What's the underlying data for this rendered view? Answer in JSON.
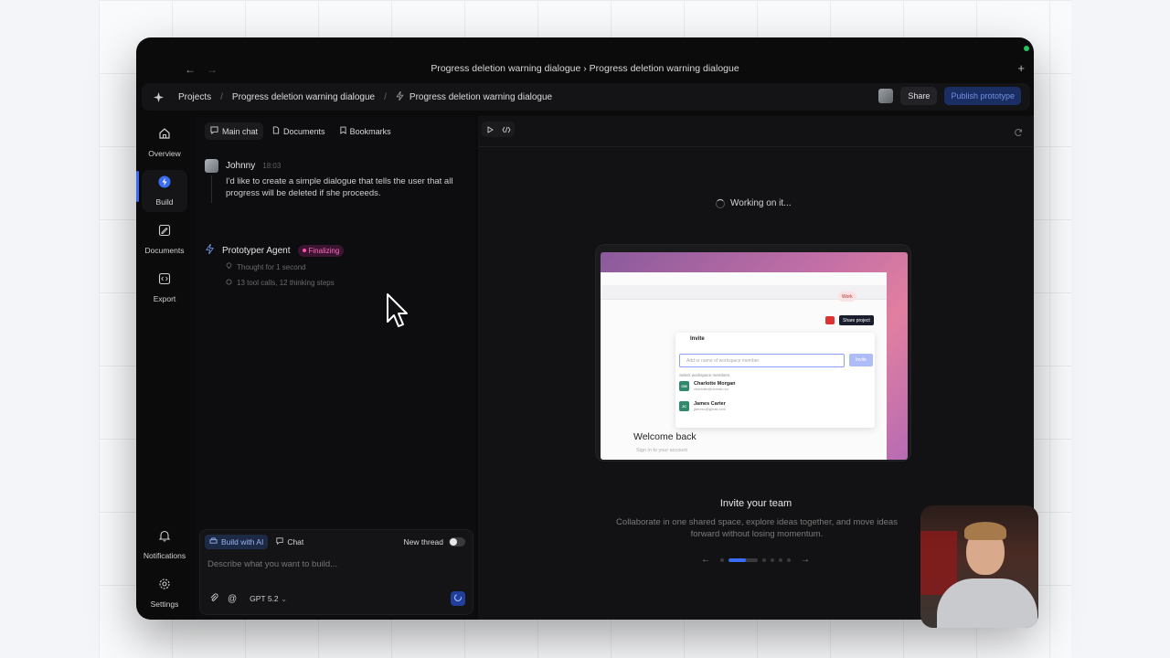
{
  "window": {
    "title": "Progress deletion warning dialogue › Progress deletion warning dialogue"
  },
  "breadcrumb": {
    "items": [
      "Projects",
      "Progress deletion warning dialogue",
      "Progress deletion warning dialogue"
    ],
    "share_label": "Share",
    "publish_label": "Publish prototype"
  },
  "sidebar": {
    "items": [
      {
        "label": "Overview",
        "icon": "home-icon"
      },
      {
        "label": "Build",
        "icon": "bolt-icon"
      },
      {
        "label": "Documents",
        "icon": "edit-document-icon"
      },
      {
        "label": "Export",
        "icon": "code-icon"
      }
    ],
    "bottom": [
      {
        "label": "Notifications",
        "icon": "bell-icon"
      },
      {
        "label": "Settings",
        "icon": "gear-icon"
      }
    ]
  },
  "chat": {
    "tabs": [
      "Main chat",
      "Documents",
      "Bookmarks"
    ],
    "message": {
      "author": "Johnny",
      "time": "18:03",
      "text": "I'd like to create a simple dialogue that tells the user that all progress will be deleted if she proceeds."
    },
    "agent": {
      "name": "Prototyper Agent",
      "status": "Finalizing",
      "thought": "Thought for 1 second",
      "steps": "13 tool calls, 12 thinking steps"
    },
    "composer": {
      "mode_build": "Build with AI",
      "mode_chat": "Chat",
      "new_thread": "New thread",
      "placeholder": "Describe what you want to build...",
      "model": "GPT 5.2"
    }
  },
  "preview": {
    "status": "Working on it...",
    "mock": {
      "work_badge": "Work",
      "share_project": "Share project",
      "invite_title": "Invite",
      "invite_placeholder": "Add or name of workspace member",
      "invite_button": "Invite",
      "select_label": "Select workspace members",
      "members": [
        {
          "initials": "CM",
          "name": "Charlotte Morgan",
          "email": "charlotte@domain.co"
        },
        {
          "initials": "JC",
          "name": "James Carter",
          "email": "jamesc@gmail.com"
        }
      ],
      "welcome": "Welcome back",
      "signin": "Sign in to your account"
    },
    "title": "Invite your team",
    "description": "Collaborate in one shared space, explore ideas together, and move ideas forward without losing momentum.",
    "pager": {
      "current": 1,
      "total": 6
    }
  },
  "colors": {
    "accent": "#3b6cf6",
    "finalizing": "#ff6bbd",
    "background": "#0b0b0c"
  }
}
